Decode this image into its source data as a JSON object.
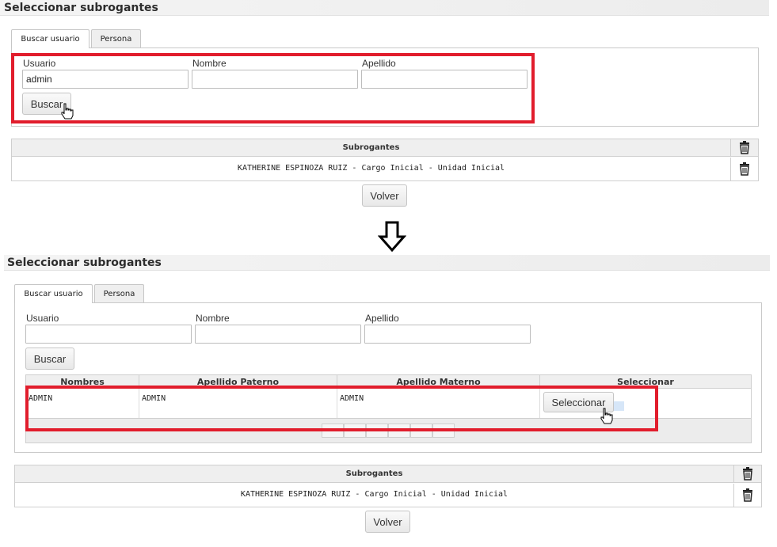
{
  "top": {
    "title": "Seleccionar subrogantes",
    "tabs": [
      {
        "label": "Buscar usuario"
      },
      {
        "label": "Persona"
      }
    ],
    "form": {
      "usuario_label": "Usuario",
      "usuario_value": "admin",
      "nombre_label": "Nombre",
      "nombre_value": "",
      "apellido_label": "Apellido",
      "apellido_value": "",
      "buscar_label": "Buscar"
    },
    "subrogantes": {
      "header": "Subrogantes",
      "rows": [
        {
          "text": "KATHERINE ESPINOZA RUIZ - Cargo Inicial - Unidad Inicial"
        }
      ]
    },
    "volver_label": "Volver"
  },
  "bottom": {
    "title": "Seleccionar subrogantes",
    "tabs": [
      {
        "label": "Buscar usuario"
      },
      {
        "label": "Persona"
      }
    ],
    "form": {
      "usuario_label": "Usuario",
      "usuario_value": "",
      "nombre_label": "Nombre",
      "nombre_value": "",
      "apellido_label": "Apellido",
      "apellido_value": "",
      "buscar_label": "Buscar"
    },
    "results": {
      "columns": [
        "Nombres",
        "Apellido Paterno",
        "Apellido Materno",
        "Seleccionar"
      ],
      "rows": [
        {
          "nombres": "ADMIN",
          "paterno": "ADMIN",
          "materno": "ADMIN",
          "action": "Seleccionar"
        }
      ]
    },
    "subrogantes": {
      "header": "Subrogantes",
      "rows": [
        {
          "text": "KATHERINE ESPINOZA RUIZ - Cargo Inicial - Unidad Inicial"
        }
      ]
    },
    "volver_label": "Volver"
  },
  "icons": {
    "trash": "trash-icon",
    "arrow": "down-arrow-icon",
    "cursor": "hand-pointer-icon"
  },
  "colors": {
    "highlight": "#e11d2c"
  }
}
